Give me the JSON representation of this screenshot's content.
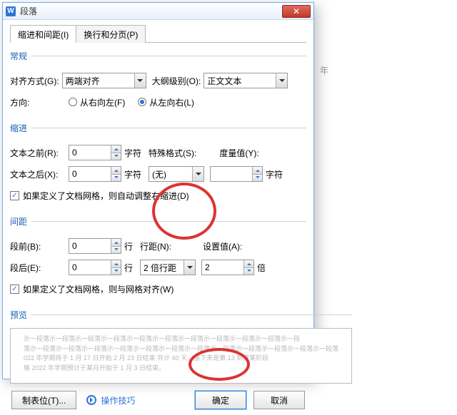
{
  "dialog": {
    "app_icon": "W",
    "title": "段落",
    "close_label": "✕"
  },
  "tabs": {
    "indent": "缩进和间距(I)",
    "pagination": "换行和分页(P)"
  },
  "general": {
    "legend": "常规",
    "align_label": "对齐方式(G):",
    "align_value": "两端对齐",
    "outline_label": "大纲级别(O):",
    "outline_value": "正文文本",
    "direction_label": "方向:",
    "rtl_label": "从右向左(F)",
    "ltr_label": "从左向右(L)"
  },
  "indent": {
    "legend": "缩进",
    "before_label": "文本之前(R):",
    "before_value": "0",
    "after_label": "文本之后(X):",
    "after_value": "0",
    "char_unit": "字符",
    "special_label": "特殊格式(S):",
    "special_value": "(无)",
    "measure_label": "度量值(Y):",
    "char_unit2": "字符",
    "grid_check": "如果定义了文档网格，则自动调整右缩进(D)"
  },
  "spacing": {
    "legend": "间距",
    "before_label": "段前(B):",
    "before_value": "0",
    "after_label": "段后(E):",
    "after_value": "0",
    "line_unit": "行",
    "line_spacing_label": "行距(N):",
    "line_spacing_value": "2 倍行距",
    "set_label": "设置值(A):",
    "set_value": "2",
    "times_unit": "倍",
    "grid_check": "如果定义了文档网格，则与网格对齐(W)"
  },
  "preview": {
    "legend": "预览",
    "l1": "示一段落示一段落示一段落示一段落示一段落示一段落示一段落示一段落示一段落示一段落示一段",
    "l2": "落示一段落示一段落示一段落示一段落示一段落示一段落示一段落示一段落示一段落示一段落示一段落示一段落",
    "l3": "022 年学期将于 1 月 17 日开始 2 月 23 日结束 共计 40 天，接下来是第 13 到第某阶段",
    "l4": "格 2022 年学期预计于某月开始于 1 月 3 日结束。"
  },
  "footer": {
    "tabstops": "制表位(T)...",
    "tips": "操作技巧",
    "ok": "确定",
    "cancel": "取消"
  },
  "background": {
    "year_marker": "年"
  }
}
